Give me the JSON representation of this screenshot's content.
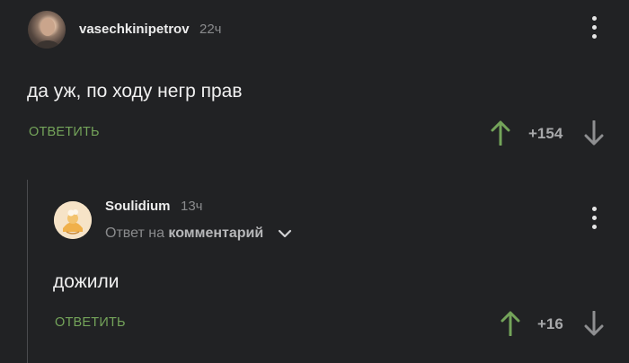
{
  "comments": [
    {
      "username": "vasechkinipetrov",
      "time": "22ч",
      "text": "да уж, по ходу негр прав",
      "reply_label": "ОТВЕТИТЬ",
      "score": "+154"
    },
    {
      "username": "Soulidium",
      "time": "13ч",
      "reply_to_prefix": "Ответ на",
      "reply_to_target": "комментарий",
      "text": "дожили",
      "reply_label": "ОТВЕТИТЬ",
      "score": "+16"
    }
  ],
  "colors": {
    "background": "#212224",
    "upvote": "#74a45a",
    "downvote": "#8e8f91",
    "reply_button": "#74a45a"
  },
  "icons": {
    "upvote": "arrow-up-icon",
    "downvote": "arrow-down-icon",
    "menu": "kebab-menu-icon",
    "expand": "chevron-down-icon"
  }
}
